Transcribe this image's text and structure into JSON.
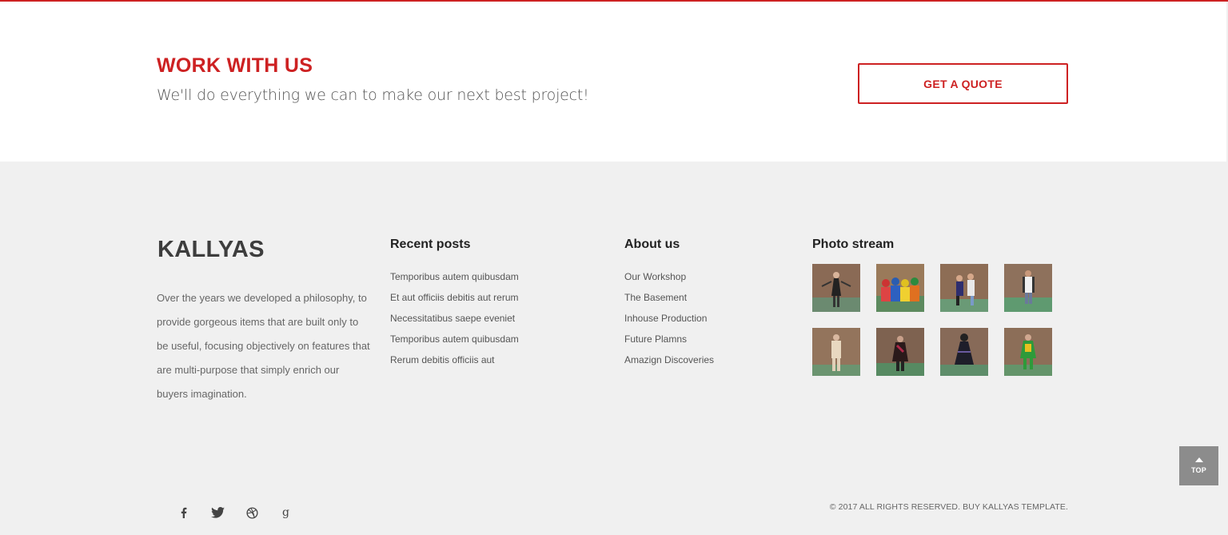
{
  "cta": {
    "title": "WORK WITH US",
    "subtitle": "We'll do everything we can to make our next best project!",
    "button_label": "GET A QUOTE"
  },
  "footer": {
    "logo": "KALLYAS",
    "about_text": "Over the years we developed a philosophy, to provide gorgeous items that are built only to be useful, focusing objectively on features that are multi-purpose that simply enrich our buyers imagination.",
    "recent_posts": {
      "heading": "Recent posts",
      "items": [
        "Temporibus autem quibusdam",
        "Et aut officiis debitis aut rerum",
        "Necessitatibus saepe eveniet",
        "Temporibus autem quibusdam",
        "Rerum debitis officiis aut"
      ]
    },
    "about_us": {
      "heading": "About us",
      "items": [
        "Our Workshop",
        "The Basement",
        "Inhouse Production",
        "Future Plamns",
        "Amazign Discoveries"
      ]
    },
    "photo_stream": {
      "heading": "Photo stream",
      "photos": [
        "photo-1",
        "photo-2",
        "photo-3",
        "photo-4",
        "photo-5",
        "photo-6",
        "photo-7",
        "photo-8"
      ]
    },
    "social_icons": [
      "facebook-icon",
      "twitter-icon",
      "dribbble-icon",
      "google-icon"
    ],
    "copyright": "© 2017 ALL RIGHTS RESERVED. BUY KALLYAS TEMPLATE.",
    "top_button_label": "TOP"
  },
  "colors": {
    "accent": "#cd2122",
    "footer_bg": "#f0f0f0",
    "top_button_bg": "#8c8c8c"
  }
}
